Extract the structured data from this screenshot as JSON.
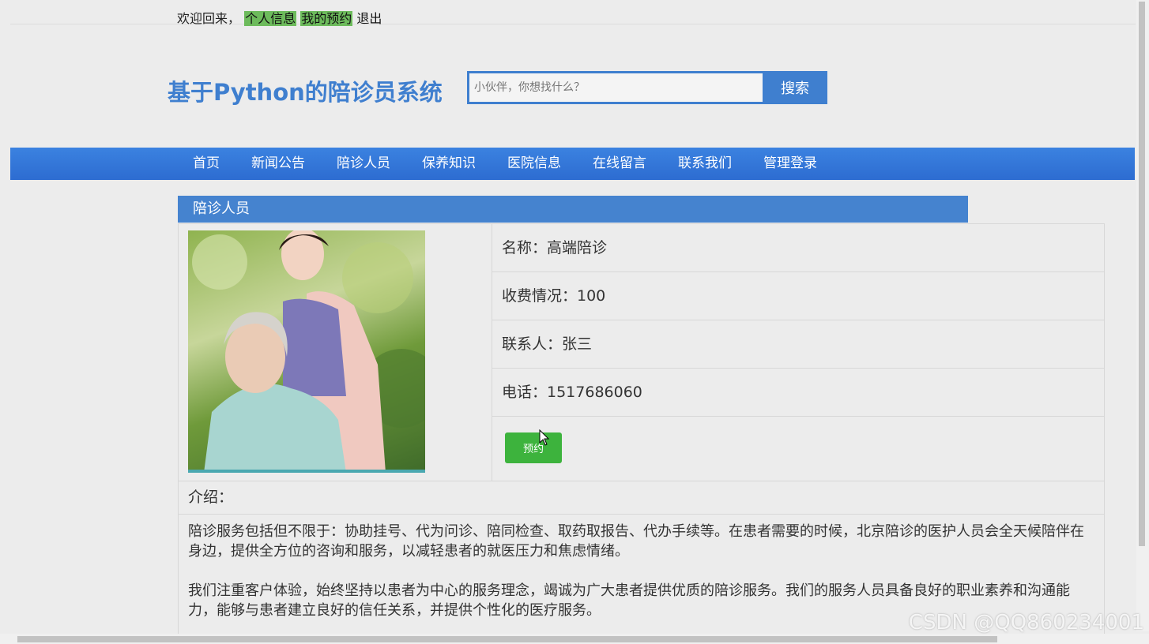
{
  "topbar": {
    "welcome": "欢迎回来，",
    "profile_link": "个人信息",
    "appointments_link": "我的预约",
    "logout_link": "退出"
  },
  "header": {
    "site_title": "基于Python的陪诊员系统",
    "search_placeholder": "小伙伴，你想找什么？",
    "search_button": "搜索"
  },
  "nav": {
    "items": [
      {
        "label": "首页"
      },
      {
        "label": "新闻公告"
      },
      {
        "label": "陪诊人员"
      },
      {
        "label": "保养知识"
      },
      {
        "label": "医院信息"
      },
      {
        "label": "在线留言"
      },
      {
        "label": "联系我们"
      },
      {
        "label": "管理登录"
      }
    ]
  },
  "section": {
    "heading": "陪诊人员"
  },
  "detail": {
    "name": "名称：高端陪诊",
    "fee": "收费情况：100",
    "contact": "联系人：张三",
    "phone": "电话：1517686060",
    "book_button": "预约"
  },
  "intro": {
    "heading": "介绍：",
    "paragraphs": [
      "陪诊服务包括但不限于：协助挂号、代为问诊、陪同检查、取药取报告、代办手续等。在患者需要的时候，北京陪诊的医护人员会全天候陪伴在身边，提供全方位的咨询和服务，以减轻患者的就医压力和焦虑情绪。",
      "我们注重客户体验，始终坚持以患者为中心的服务理念，竭诚为广大患者提供优质的陪诊服务。我们的服务人员具备良好的职业素养和沟通能力，能够与患者建立良好的信任关系，并提供个性化的医疗服务。"
    ]
  },
  "watermark": "CSDN @QQ860234001"
}
